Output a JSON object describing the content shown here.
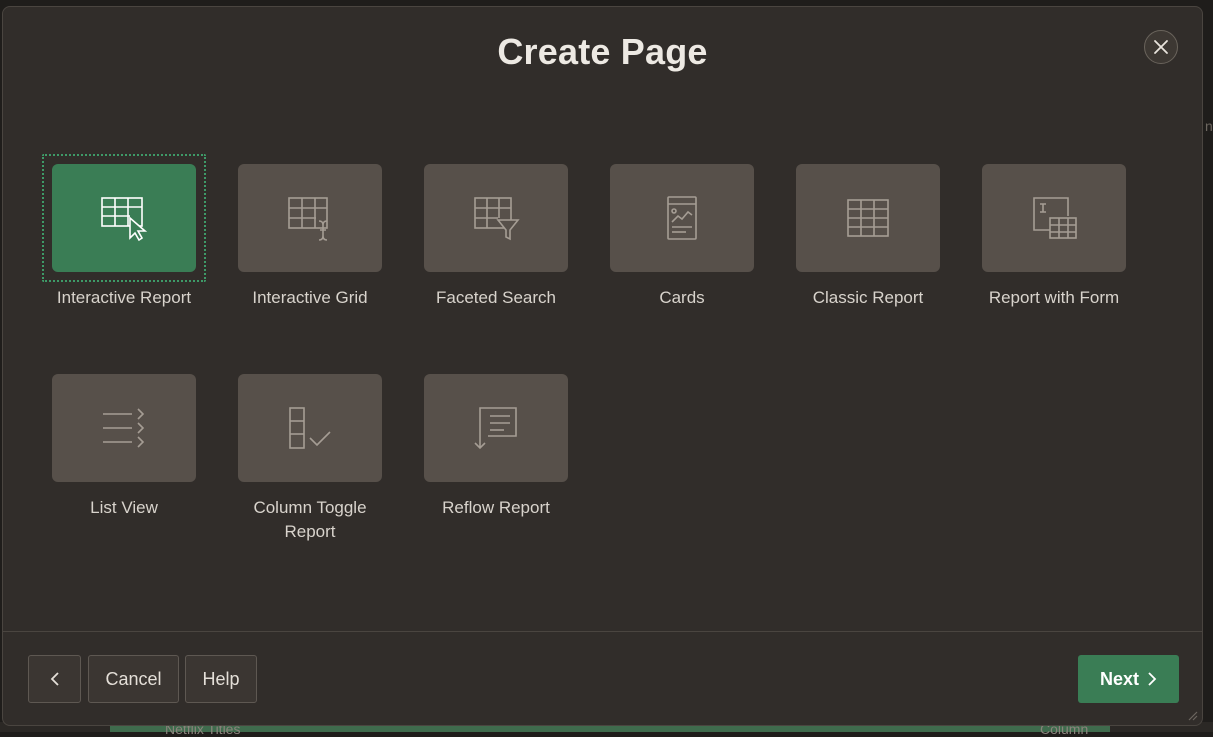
{
  "dialog": {
    "title": "Create Page",
    "close_label": "Close"
  },
  "tiles": [
    {
      "label": "Interactive Report",
      "icon": "interactive-report-icon",
      "selected": true
    },
    {
      "label": "Interactive Grid",
      "icon": "interactive-grid-icon"
    },
    {
      "label": "Faceted Search",
      "icon": "faceted-search-icon"
    },
    {
      "label": "Cards",
      "icon": "cards-icon"
    },
    {
      "label": "Classic Report",
      "icon": "classic-report-icon"
    },
    {
      "label": "Report with Form",
      "icon": "report-with-form-icon"
    },
    {
      "label": "List View",
      "icon": "list-view-icon"
    },
    {
      "label": "Column Toggle",
      "label2": "Report",
      "icon": "column-toggle-report-icon"
    },
    {
      "label": "Reflow Report",
      "icon": "reflow-report-icon"
    }
  ],
  "footer": {
    "cancel_label": "Cancel",
    "help_label": "Help",
    "next_label": "Next"
  },
  "background": {
    "left_text": "Netflix Titles",
    "right_text": "Column",
    "edge_text": "nt"
  },
  "colors": {
    "dialog_bg": "#312d2a",
    "tile_bg": "#57504a",
    "accent_green": "#3a7d55",
    "text": "#d8d3cc"
  }
}
